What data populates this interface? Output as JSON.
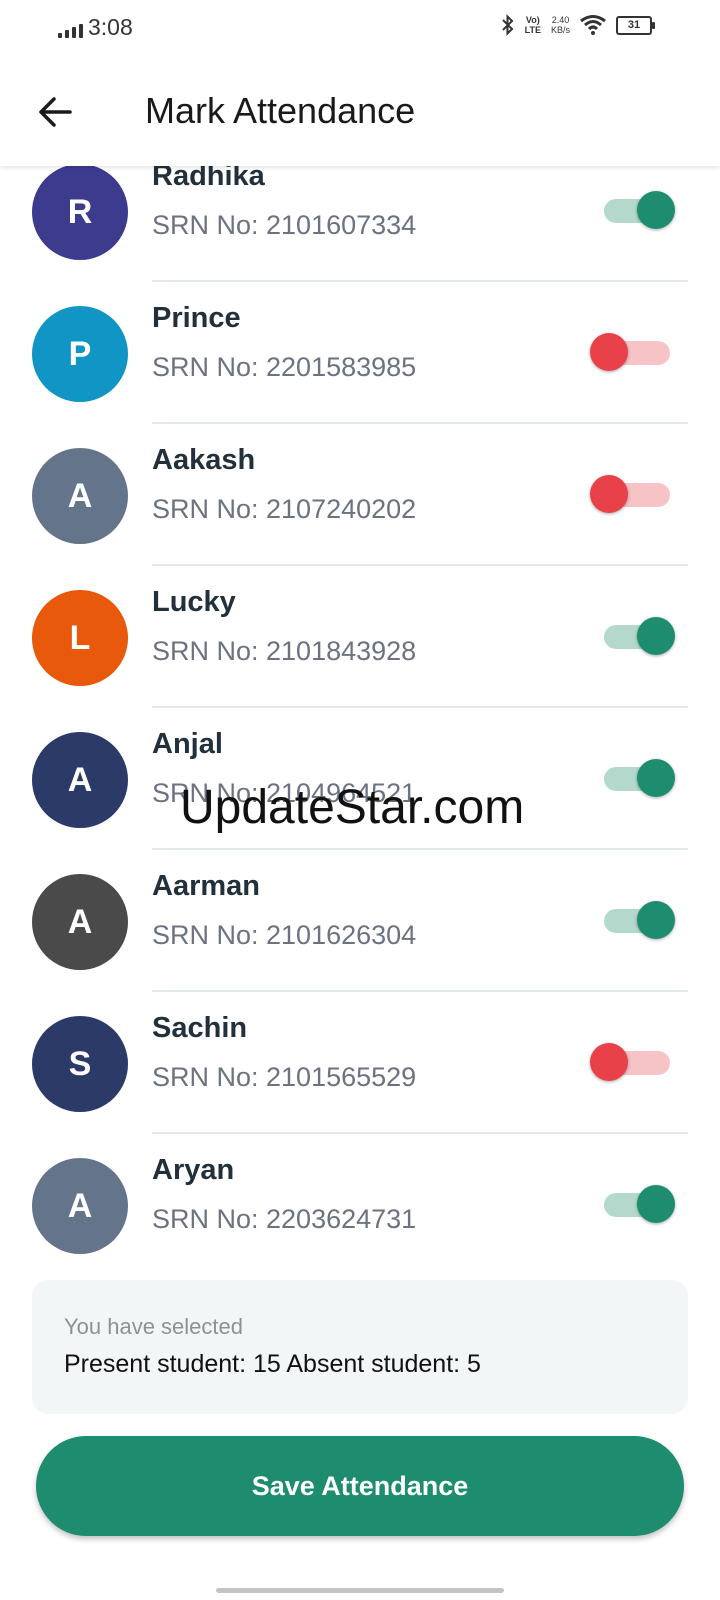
{
  "status_bar": {
    "time": "3:08",
    "network_top": "Vo)",
    "network_bottom": "LTE",
    "speed_top": "2.40",
    "speed_bottom": "KB/s",
    "battery": "31"
  },
  "header": {
    "title": "Mark Attendance",
    "back_icon": "arrow-left-icon"
  },
  "students": [
    {
      "initial": "R",
      "name": "Radhika",
      "srn": "SRN No: 2101607334",
      "present": true,
      "color": "#3d3b8e"
    },
    {
      "initial": "P",
      "name": "Prince",
      "srn": "SRN No: 2201583985",
      "present": false,
      "color": "#1195c5"
    },
    {
      "initial": "A",
      "name": "Aakash",
      "srn": "SRN No: 2107240202",
      "present": false,
      "color": "#64748b"
    },
    {
      "initial": "L",
      "name": "Lucky",
      "srn": "SRN No: 2101843928",
      "present": true,
      "color": "#e8590c"
    },
    {
      "initial": "A",
      "name": "Anjal",
      "srn": "SRN No: 2104964521",
      "present": true,
      "color": "#2b3a67"
    },
    {
      "initial": "A",
      "name": "Aarman",
      "srn": "SRN No: 2101626304",
      "present": true,
      "color": "#4a4a4a"
    },
    {
      "initial": "S",
      "name": "Sachin",
      "srn": "SRN No: 2101565529",
      "present": false,
      "color": "#2b3a67"
    },
    {
      "initial": "A",
      "name": "Aryan",
      "srn": "SRN No: 2203624731",
      "present": true,
      "color": "#64748b"
    }
  ],
  "summary": {
    "label": "You have selected",
    "counts": "Present student: 15 Absent student: 5"
  },
  "save_button": {
    "label": "Save Attendance"
  },
  "watermark": "UpdateStar.com",
  "colors": {
    "accent": "#1e8c6e",
    "present_track": "#b4d9cc",
    "absent": "#e9414a",
    "absent_track": "#f6c3c6"
  }
}
